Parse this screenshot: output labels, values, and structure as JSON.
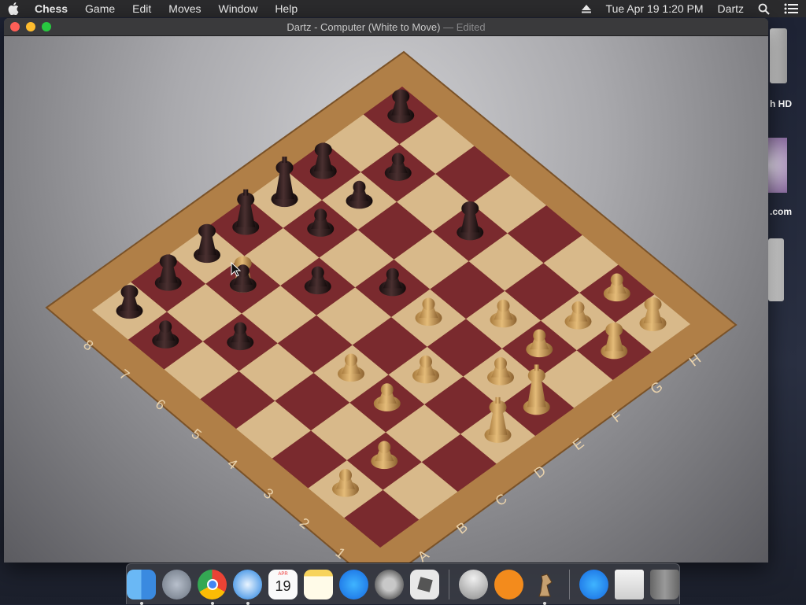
{
  "menubar": {
    "app_name": "Chess",
    "menus": [
      "Game",
      "Edit",
      "Moves",
      "Window",
      "Help"
    ],
    "clock": "Tue Apr 19  1:20 PM",
    "user": "Dartz"
  },
  "window": {
    "title": "Dartz - Computer   (White to Move)",
    "edited": "— Edited"
  },
  "board": {
    "files": [
      "A",
      "B",
      "C",
      "D",
      "E",
      "F",
      "G",
      "H"
    ],
    "ranks": [
      "1",
      "2",
      "3",
      "4",
      "5",
      "6",
      "7",
      "8"
    ],
    "light_color": "#d8b98a",
    "dark_color": "#7a2a2e",
    "frame_color": "#b07f47"
  },
  "desktop": {
    "label_hd": "h HD",
    "label_com": ".com"
  },
  "dock": {
    "calendar_month": "APR",
    "calendar_day": "19",
    "apps": [
      "finder-icon",
      "launchpad-icon",
      "chrome-icon",
      "safari-icon",
      "calendar-icon",
      "notes-icon",
      "app-store-icon",
      "system-preferences-icon",
      "roblox-icon",
      "automator-icon",
      "books-icon",
      "chess-icon",
      "app-store-icon",
      "file-icon",
      "trash-icon"
    ]
  }
}
